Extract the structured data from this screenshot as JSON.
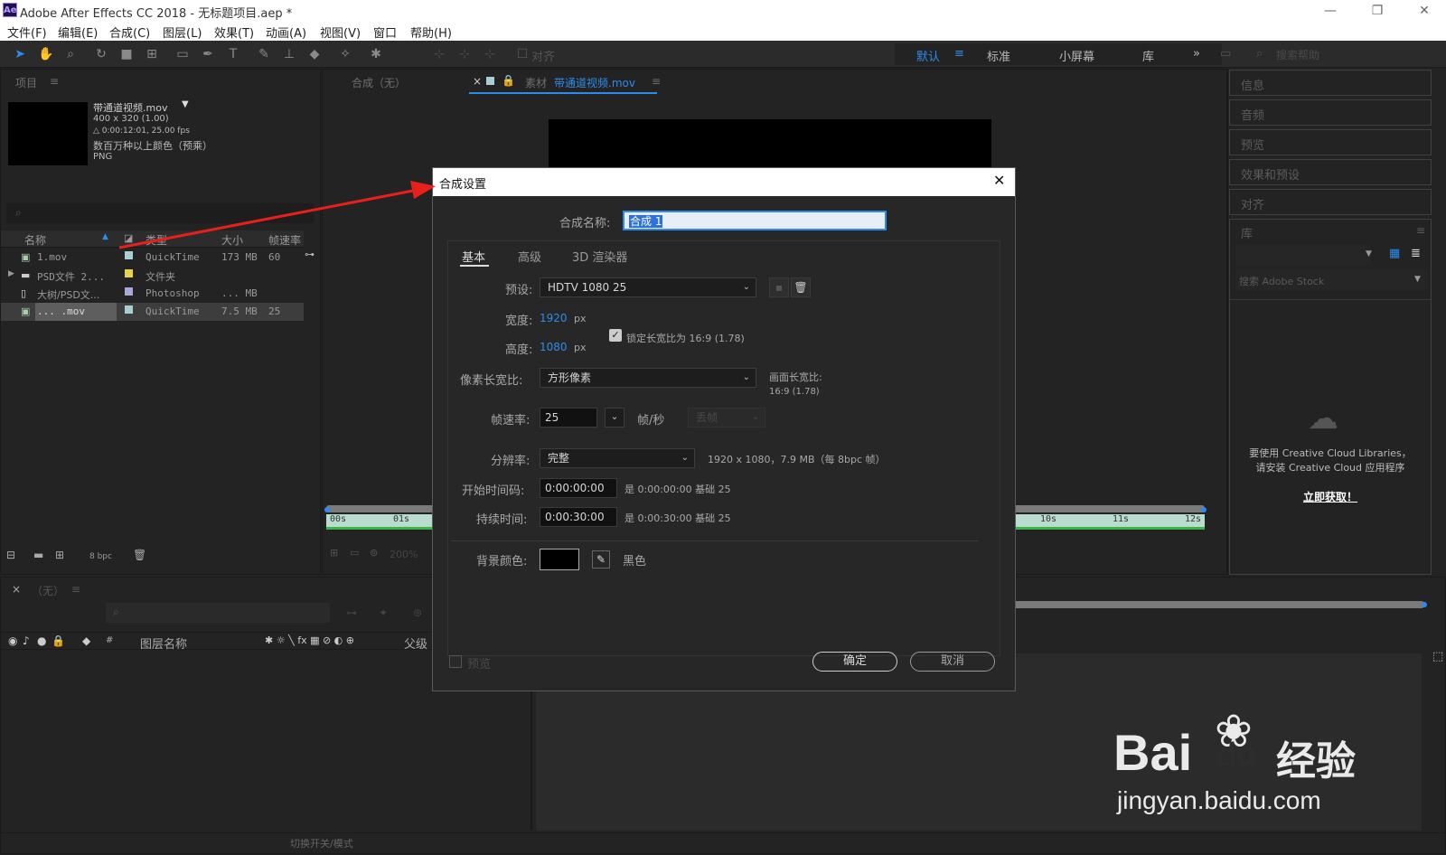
{
  "window": {
    "title": "Adobe After Effects CC 2018 - 无标题项目.aep *",
    "logo": "Ae",
    "min": "—",
    "max": "❐",
    "close": "✕"
  },
  "menu": [
    "文件(F)",
    "编辑(E)",
    "合成(C)",
    "图层(L)",
    "效果(T)",
    "动画(A)",
    "视图(V)",
    "窗口",
    "帮助(H)"
  ],
  "toolbar": {
    "align_label": "对齐",
    "workspaces": [
      "默认",
      "标准",
      "小屏幕",
      "库"
    ],
    "more": "»",
    "search_placeholder": "搜索帮助"
  },
  "project": {
    "panel_title": "项目",
    "footage_name": "带通道视频.mov",
    "footage_dims": "400 x 320 (1.00)",
    "footage_duration": "△ 0:00:12:01, 25.00 fps",
    "footage_colors": "数百万种以上颜色（预乘）",
    "footage_codec": "PNG",
    "columns": [
      "名称",
      "类型",
      "大小",
      "帧速率"
    ],
    "rows": [
      {
        "name": "1.mov",
        "type": "QuickTime",
        "size": "173 MB",
        "fps": "60",
        "color": "#a8d0d0"
      },
      {
        "name": "PSD文件 2...",
        "type": "文件夹",
        "size": "",
        "fps": "",
        "color": "#e6d34a"
      },
      {
        "name": "大树/PSD文...",
        "type": "Photoshop",
        "size": "... MB",
        "fps": "",
        "color": "#a8a8d8"
      },
      {
        "name": "... .mov",
        "type": "QuickTime",
        "size": "7.5 MB",
        "fps": "25",
        "color": "#a8d0d0"
      }
    ],
    "bpc": "8 bpc"
  },
  "comp_viewer": {
    "tab_none": "合成（无）",
    "tab_footage_prefix": "素材",
    "tab_footage_name": "带通道视频.mov",
    "zoom": "200%",
    "ruler": [
      "00s",
      "01s",
      "10s",
      "11s",
      "12s"
    ]
  },
  "right_panels": [
    "信息",
    "音频",
    "预览",
    "效果和预设",
    "对齐",
    "库"
  ],
  "library": {
    "search_placeholder": "搜索 Adobe Stock",
    "msg1": "要使用 Creative Cloud Libraries，",
    "msg2": "请安装 Creative Cloud 应用程序",
    "link": "立即获取！"
  },
  "timeline": {
    "tab": "（无）",
    "col_layer_name": "图层名称",
    "col_parent": "父级",
    "col_num": "#",
    "toggle_label": "切换开关/模式"
  },
  "dialog": {
    "title": "合成设置",
    "name_label": "合成名称:",
    "name_value": "合成 1",
    "tabs": [
      "基本",
      "高级",
      "3D 渲染器"
    ],
    "preset_label": "预设:",
    "preset_value": "HDTV 1080 25",
    "width_label": "宽度:",
    "width_value": "1920",
    "height_label": "高度:",
    "height_value": "1080",
    "px": "px",
    "lock_label": "锁定长宽比为 16:9 (1.78)",
    "pixel_aspect_label": "像素长宽比:",
    "pixel_aspect_value": "方形像素",
    "frame_aspect_label": "画面长宽比:",
    "frame_aspect_value": "16:9 (1.78)",
    "fps_label": "帧速率:",
    "fps_value": "25",
    "fps_unit": "帧/秒",
    "drop_value": "丢帧",
    "res_label": "分辨率:",
    "res_value": "完整",
    "res_info": "1920 x 1080，7.9 MB（每 8bpc 帧）",
    "start_label": "开始时间码:",
    "start_value": "0:00:00:00",
    "start_info": "是 0:00:00:00  基础 25",
    "dur_label": "持续时间:",
    "dur_value": "0:00:30:00",
    "dur_info": "是 0:00:30:00  基础 25",
    "bg_label": "背景颜色:",
    "bg_name": "黑色",
    "bg_color": "#000000",
    "preview_label": "预览",
    "ok": "确定",
    "cancel": "取消"
  },
  "watermark": {
    "brand": "Bai",
    "brand2": "du",
    "jy": "经验",
    "url": "jingyan.baidu.com"
  }
}
